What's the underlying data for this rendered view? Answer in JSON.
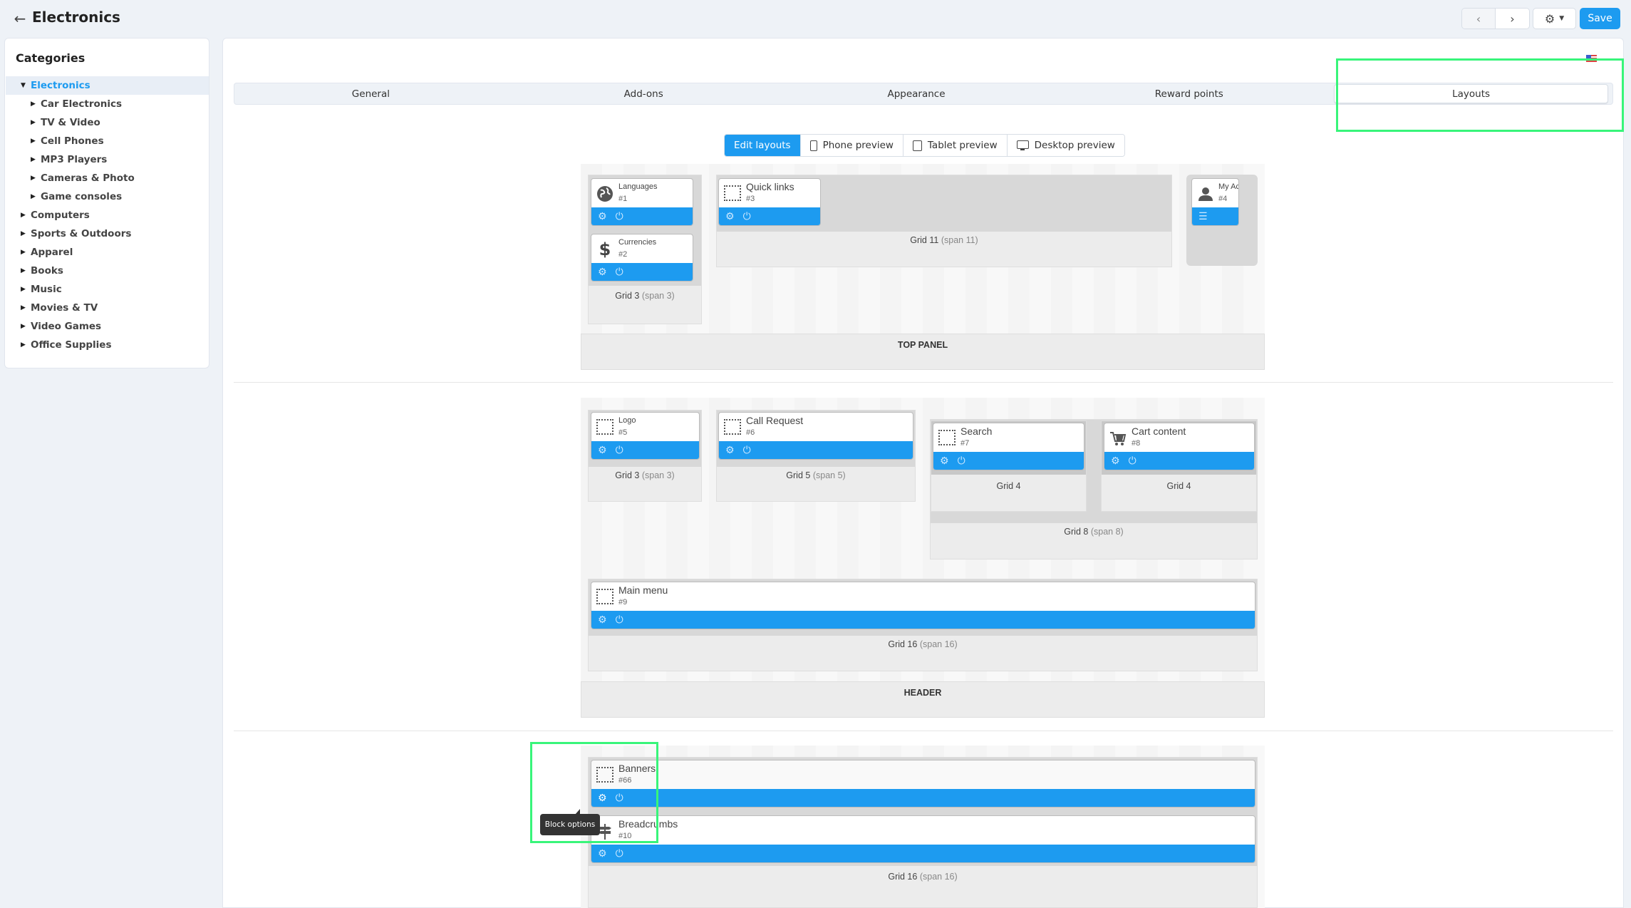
{
  "header": {
    "back_icon": "arrow-left-icon",
    "title": "Electronics",
    "prev_icon": "chevron-left-icon",
    "next_icon": "chevron-right-icon",
    "settings_icon": "gear-icon",
    "save_label": "Save",
    "accent_color": "#1d9bf0"
  },
  "sidebar": {
    "title": "Categories",
    "items": [
      {
        "label": "Electronics",
        "level": 1,
        "expanded": true,
        "active": true
      },
      {
        "label": "Car Electronics",
        "level": 2
      },
      {
        "label": "TV & Video",
        "level": 2
      },
      {
        "label": "Cell Phones",
        "level": 2
      },
      {
        "label": "MP3 Players",
        "level": 2
      },
      {
        "label": "Cameras & Photo",
        "level": 2
      },
      {
        "label": "Game consoles",
        "level": 2
      },
      {
        "label": "Computers",
        "level": 1
      },
      {
        "label": "Sports & Outdoors",
        "level": 1
      },
      {
        "label": "Apparel",
        "level": 1
      },
      {
        "label": "Books",
        "level": 1
      },
      {
        "label": "Music",
        "level": 1
      },
      {
        "label": "Movies & TV",
        "level": 1
      },
      {
        "label": "Video Games",
        "level": 1
      },
      {
        "label": "Office Supplies",
        "level": 1
      }
    ]
  },
  "tabs": [
    {
      "label": "General"
    },
    {
      "label": "Add-ons"
    },
    {
      "label": "Appearance"
    },
    {
      "label": "Reward points"
    },
    {
      "label": "Layouts",
      "active": true
    }
  ],
  "language_flag": "us-flag-icon",
  "previews": [
    {
      "label": "Edit layouts",
      "active": true
    },
    {
      "label": "Phone preview",
      "icon": "phone-icon"
    },
    {
      "label": "Tablet preview",
      "icon": "tablet-icon"
    },
    {
      "label": "Desktop preview",
      "icon": "desktop-icon"
    }
  ],
  "layout": {
    "top_panel": {
      "label": "TOP PANEL",
      "grids": [
        {
          "name": "Grid 3",
          "span": "(span 3)",
          "blocks": [
            {
              "name": "Languages",
              "id": "#1",
              "icon": "globe-icon"
            },
            {
              "name": "Currencies",
              "id": "#2",
              "icon": "dollar-icon"
            }
          ]
        },
        {
          "name": "Grid 11",
          "span": "(span 11)",
          "blocks": [
            {
              "name": "Quick links",
              "id": "#3",
              "icon": "placeholder-icon"
            }
          ]
        },
        {
          "name": "",
          "span": "",
          "blocks": [
            {
              "name": "My Accou",
              "id": "#4",
              "icon": "user-icon"
            }
          ]
        }
      ]
    },
    "header": {
      "label": "HEADER",
      "grids": [
        {
          "name": "Grid 3",
          "span": "(span 3)",
          "blocks": [
            {
              "name": "Logo",
              "id": "#5",
              "icon": "placeholder-icon"
            }
          ]
        },
        {
          "name": "Grid 5",
          "span": "(span 5)",
          "blocks": [
            {
              "name": "Call Request",
              "id": "#6",
              "icon": "placeholder-icon"
            }
          ]
        },
        {
          "name": "Grid 8",
          "span": "(span 8)",
          "subgrids": [
            {
              "name": "Grid 4",
              "blocks": [
                {
                  "name": "Search",
                  "id": "#7",
                  "icon": "placeholder-icon"
                }
              ]
            },
            {
              "name": "Grid 4",
              "blocks": [
                {
                  "name": "Cart content",
                  "id": "#8",
                  "icon": "cart-icon"
                }
              ]
            }
          ]
        },
        {
          "name": "Grid 16",
          "span": "(span 16)",
          "blocks": [
            {
              "name": "Main menu",
              "id": "#9",
              "icon": "placeholder-icon"
            }
          ]
        }
      ]
    },
    "content": {
      "grids": [
        {
          "name": "Grid 16",
          "span": "(span 16)",
          "blocks": [
            {
              "name": "Banners",
              "id": "#66",
              "icon": "placeholder-icon"
            },
            {
              "name": "Breadcrumbs",
              "id": "#10",
              "icon": "signpost-icon"
            }
          ]
        }
      ]
    }
  },
  "tooltip": "Block options"
}
